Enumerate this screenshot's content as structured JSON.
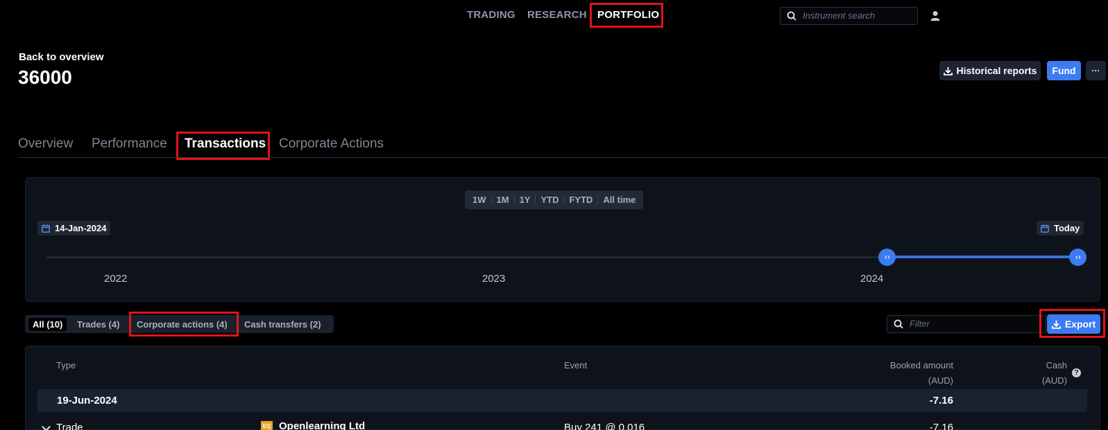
{
  "nav": {
    "items": [
      "TRADING",
      "RESEARCH",
      "PORTFOLIO"
    ],
    "search_placeholder": "Instrument search"
  },
  "header": {
    "back_label": "Back to overview",
    "account": "36000",
    "historical_reports": "Historical reports",
    "fund": "Fund",
    "more": "···"
  },
  "tabs": [
    "Overview",
    "Performance",
    "Transactions",
    "Corporate Actions"
  ],
  "timeline": {
    "periods": [
      "1W",
      "1M",
      "1Y",
      "YTD",
      "FYTD",
      "All time"
    ],
    "start_date": "14-Jan-2024",
    "end_date": "Today",
    "years": [
      "2022",
      "2023",
      "2024"
    ],
    "handle_glyph": "‹ ›"
  },
  "filters": {
    "segments": [
      "All (10)",
      "Trades (4)",
      "Corporate actions (4)",
      "Cash transfers (2)"
    ],
    "filter_placeholder": "Filter",
    "export": "Export"
  },
  "table": {
    "headers": {
      "type": "Type",
      "event": "Event",
      "booked_amount": "Booked amount",
      "booked_unit": "(AUD)",
      "cash": "Cash",
      "cash_unit": "(AUD)"
    },
    "group": {
      "date": "19-Jun-2024",
      "total": "-7.16"
    },
    "rows": [
      {
        "type": "Trade",
        "badge": "EQ",
        "instrument": "Openlearning Ltd",
        "event": "Buy 241 @ 0.016",
        "amount": "-7.16"
      }
    ]
  },
  "colors": {
    "accent": "#3d7bf2",
    "highlight": "#e1141b",
    "equity_badge": "#e8a324"
  }
}
